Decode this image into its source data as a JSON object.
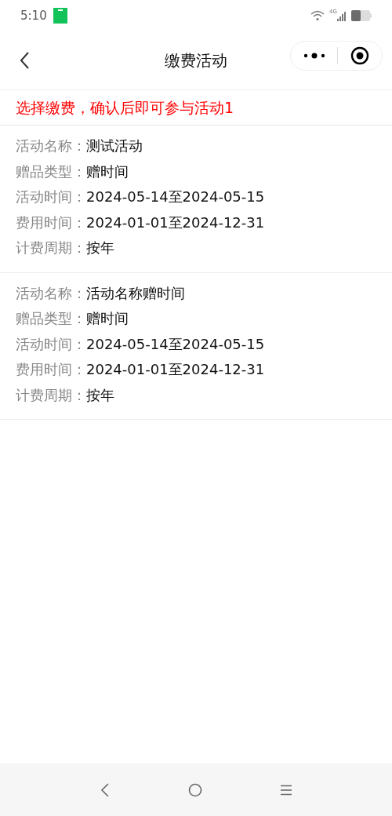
{
  "status_bar": {
    "time": "5:10",
    "network": "4G"
  },
  "nav": {
    "title": "缴费活动"
  },
  "notice": "选择缴费，确认后即可参与活动1",
  "activities": [
    {
      "fields": [
        {
          "label": "活动名称：",
          "value": "测试活动"
        },
        {
          "label": "赠品类型：",
          "value": "赠时间"
        },
        {
          "label": "活动时间：",
          "value": "2024-05-14至2024-05-15"
        },
        {
          "label": "费用时间：",
          "value": "2024-01-01至2024-12-31"
        },
        {
          "label": "计费周期：",
          "value": "按年"
        }
      ]
    },
    {
      "fields": [
        {
          "label": "活动名称：",
          "value": "活动名称赠时间"
        },
        {
          "label": "赠品类型：",
          "value": "赠时间"
        },
        {
          "label": "活动时间：",
          "value": "2024-05-14至2024-05-15"
        },
        {
          "label": "费用时间：",
          "value": "2024-01-01至2024-12-31"
        },
        {
          "label": "计费周期：",
          "value": "按年"
        }
      ]
    }
  ]
}
